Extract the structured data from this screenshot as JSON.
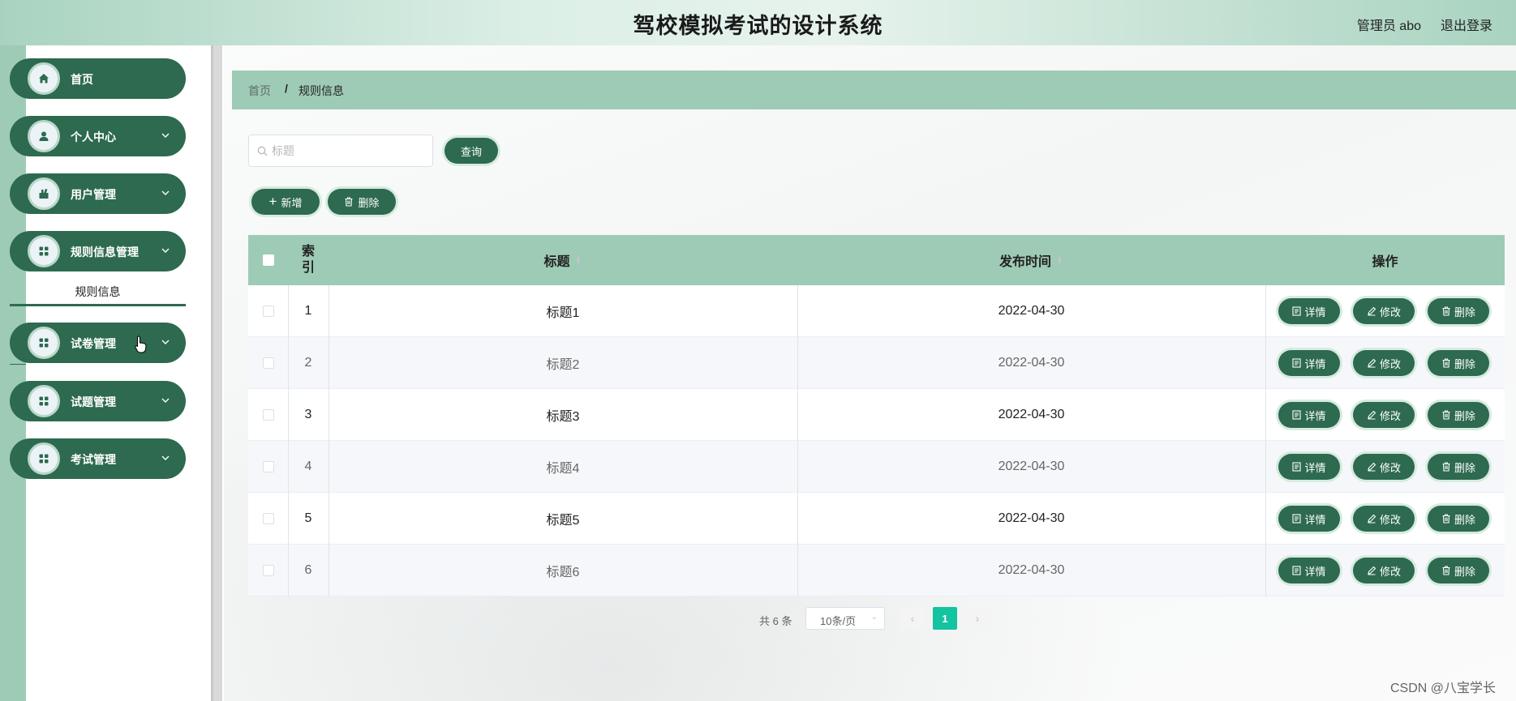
{
  "header": {
    "title": "驾校模拟考试的设计系统",
    "user": "管理员 abo",
    "logout": "退出登录"
  },
  "sidebar": {
    "items": [
      {
        "label": "首页",
        "icon": "home-icon",
        "has_arrow": false
      },
      {
        "label": "个人中心",
        "icon": "user-icon",
        "has_arrow": true
      },
      {
        "label": "用户管理",
        "icon": "user-manage-icon",
        "has_arrow": true
      },
      {
        "label": "规则信息管理",
        "icon": "grid-icon",
        "has_arrow": true
      },
      {
        "label": "试卷管理",
        "icon": "grid-icon",
        "has_arrow": true
      },
      {
        "label": "试题管理",
        "icon": "grid-icon",
        "has_arrow": true
      },
      {
        "label": "考试管理",
        "icon": "grid-icon",
        "has_arrow": true
      }
    ],
    "submenu_active": "规则信息"
  },
  "breadcrumb": {
    "home": "首页",
    "separator": "/",
    "current": "规则信息"
  },
  "search": {
    "placeholder": "标题",
    "value": "",
    "button": "查询"
  },
  "toolbar": {
    "add": "新增",
    "delete": "删除"
  },
  "table": {
    "columns": {
      "index": "索引",
      "title": "标题",
      "time": "发布时间",
      "actions": "操作"
    },
    "rows": [
      {
        "index": "1",
        "title": "标题1",
        "time": "2022-04-30"
      },
      {
        "index": "2",
        "title": "标题2",
        "time": "2022-04-30"
      },
      {
        "index": "3",
        "title": "标题3",
        "time": "2022-04-30"
      },
      {
        "index": "4",
        "title": "标题4",
        "time": "2022-04-30"
      },
      {
        "index": "5",
        "title": "标题5",
        "time": "2022-04-30"
      },
      {
        "index": "6",
        "title": "标题6",
        "time": "2022-04-30"
      }
    ],
    "row_actions": {
      "detail": "详情",
      "edit": "修改",
      "delete": "删除"
    }
  },
  "pagination": {
    "total": "共 6 条",
    "page_size": "10条/页",
    "current_page": "1"
  },
  "watermark": "CSDN @八宝学长",
  "colors": {
    "primary": "#2d6a4f",
    "accent": "#9ecbb5",
    "active_page": "#14c3a0"
  }
}
